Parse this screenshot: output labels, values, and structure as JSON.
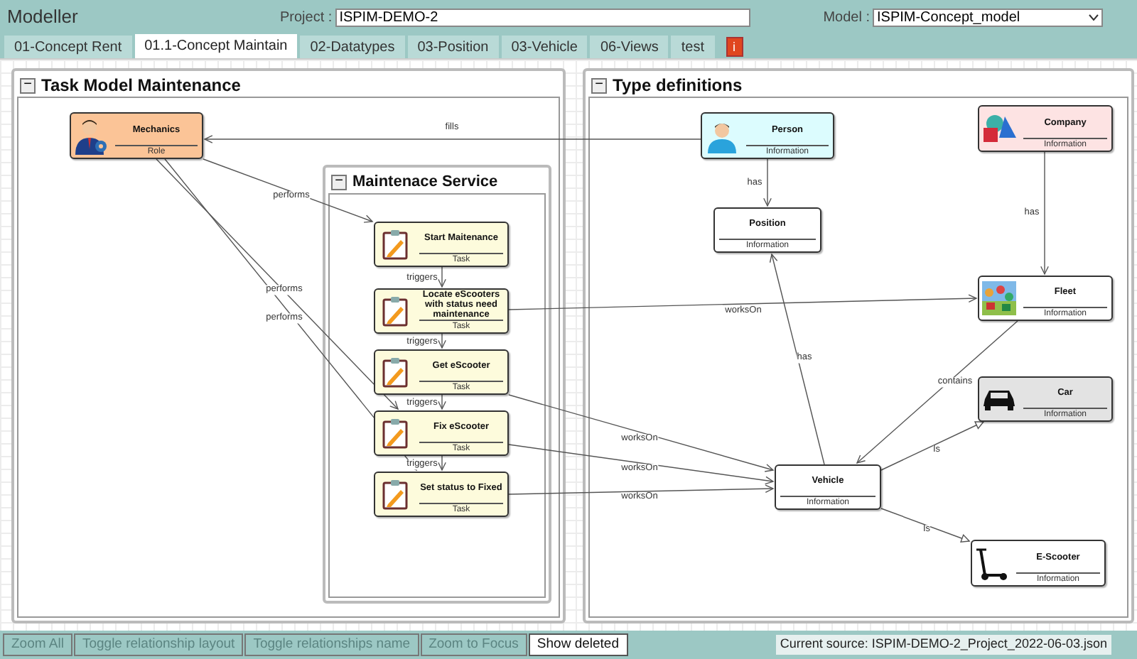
{
  "app_title": "Modeller",
  "project": {
    "label": "Project :",
    "value": "ISPIM-DEMO-2"
  },
  "model": {
    "label": "Model :",
    "value": "ISPIM-Concept_model"
  },
  "tabs": [
    {
      "label": "01-Concept Rent",
      "selected": false
    },
    {
      "label": "01.1-Concept Maintain",
      "selected": true
    },
    {
      "label": "02-Datatypes",
      "selected": false
    },
    {
      "label": "03-Position",
      "selected": false
    },
    {
      "label": "03-Vehicle",
      "selected": false
    },
    {
      "label": "06-Views",
      "selected": false
    },
    {
      "label": "test",
      "selected": false
    }
  ],
  "info_button": "i",
  "groups": [
    {
      "title": "Task Model Maintenance",
      "collapse": "−"
    },
    {
      "title": "Maintenace Service",
      "collapse": "−"
    },
    {
      "title": "Type definitions",
      "collapse": "−"
    }
  ],
  "nodes": [
    {
      "name": "Mechanics",
      "type": "Role",
      "kind": "role",
      "color": "#fbc497"
    },
    {
      "name": "Start Maitenance",
      "type": "Task",
      "kind": "task",
      "color": "#fdfbdc"
    },
    {
      "name": "Locate eScooters with status need maintenance",
      "type": "Task",
      "kind": "task",
      "color": "#fdfbdc"
    },
    {
      "name": "Get eScooter",
      "type": "Task",
      "kind": "task",
      "color": "#fdfbdc"
    },
    {
      "name": "Fix eScooter",
      "type": "Task",
      "kind": "task",
      "color": "#fdfbdc"
    },
    {
      "name": "Set status to Fixed",
      "type": "Task",
      "kind": "task",
      "color": "#fdfbdc"
    },
    {
      "name": "Person",
      "type": "Information",
      "kind": "person",
      "color": "#dcfcfe"
    },
    {
      "name": "Company",
      "type": "Information",
      "kind": "shapes",
      "color": "#fde3e3"
    },
    {
      "name": "Position",
      "type": "Information",
      "kind": "plain",
      "color": "#ffffff"
    },
    {
      "name": "Fleet",
      "type": "Information",
      "kind": "crowd",
      "color": "#ffffff"
    },
    {
      "name": "Car",
      "type": "Information",
      "kind": "car",
      "color": "#e3e3e3"
    },
    {
      "name": "Vehicle",
      "type": "Information",
      "kind": "plain",
      "color": "#ffffff"
    },
    {
      "name": "E-Scooter",
      "type": "Information",
      "kind": "scooter",
      "color": "#ffffff"
    }
  ],
  "edges": [
    {
      "label": "fills",
      "kind": "open"
    },
    {
      "label": "performs",
      "kind": "open"
    },
    {
      "label": "performs",
      "kind": "open"
    },
    {
      "label": "performs",
      "kind": "open"
    },
    {
      "label": "triggers",
      "kind": "open"
    },
    {
      "label": "triggers",
      "kind": "open"
    },
    {
      "label": "triggers",
      "kind": "open"
    },
    {
      "label": "triggers",
      "kind": "open"
    },
    {
      "label": "has",
      "kind": "open"
    },
    {
      "label": "has",
      "kind": "open"
    },
    {
      "label": "worksOn",
      "kind": "open"
    },
    {
      "label": "has",
      "kind": "open"
    },
    {
      "label": "contains",
      "kind": "open"
    },
    {
      "label": "worksOn",
      "kind": "open"
    },
    {
      "label": "worksOn",
      "kind": "open"
    },
    {
      "label": "worksOn",
      "kind": "open"
    },
    {
      "label": "Is",
      "kind": "hollow"
    },
    {
      "label": "Is",
      "kind": "hollow"
    }
  ],
  "bottom_buttons": [
    {
      "label": "Zoom All",
      "disabled": true
    },
    {
      "label": "Toggle relationship layout",
      "disabled": true
    },
    {
      "label": "Toggle relationships name",
      "disabled": true
    },
    {
      "label": "Zoom to Focus",
      "disabled": true
    },
    {
      "label": "Show deleted",
      "disabled": false
    }
  ],
  "source": "Current source: ISPIM-DEMO-2_Project_2022-06-03.json"
}
